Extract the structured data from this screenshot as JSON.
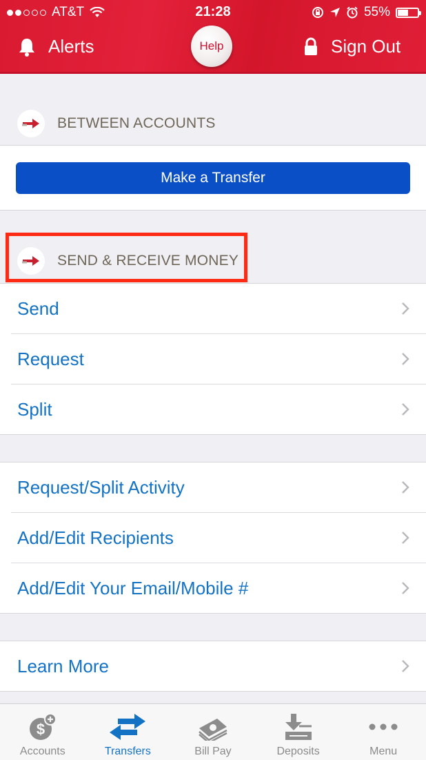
{
  "status_bar": {
    "carrier": "AT&T",
    "time": "21:28",
    "battery": "55%",
    "battery_fraction": 0.55,
    "signal_bars_filled": 2,
    "signal_bars_total": 5
  },
  "header": {
    "alerts_label": "Alerts",
    "help_label": "Help",
    "signout_label": "Sign Out"
  },
  "between_accounts": {
    "title": "BETWEEN ACCOUNTS",
    "button_label": "Make a Transfer"
  },
  "send_receive": {
    "title": "SEND & RECEIVE MONEY",
    "items": [
      {
        "label": "Send"
      },
      {
        "label": "Request"
      },
      {
        "label": "Split"
      }
    ]
  },
  "manage": {
    "items": [
      {
        "label": "Request/Split Activity"
      },
      {
        "label": "Add/Edit Recipients"
      },
      {
        "label": "Add/Edit Your Email/Mobile #"
      }
    ]
  },
  "learn": {
    "items": [
      {
        "label": "Learn More"
      }
    ]
  },
  "tabbar": {
    "tabs": [
      {
        "label": "Accounts",
        "icon": "accounts-icon"
      },
      {
        "label": "Transfers",
        "icon": "transfers-icon",
        "active": true
      },
      {
        "label": "Bill Pay",
        "icon": "bill-pay-icon"
      },
      {
        "label": "Deposits",
        "icon": "deposits-icon"
      },
      {
        "label": "Menu",
        "icon": "menu-icon"
      }
    ]
  },
  "colors": {
    "brand_red": "#e01f37",
    "link_blue": "#1372c4",
    "button_blue": "#0b4fc7",
    "highlight_red": "#ff2a14"
  }
}
